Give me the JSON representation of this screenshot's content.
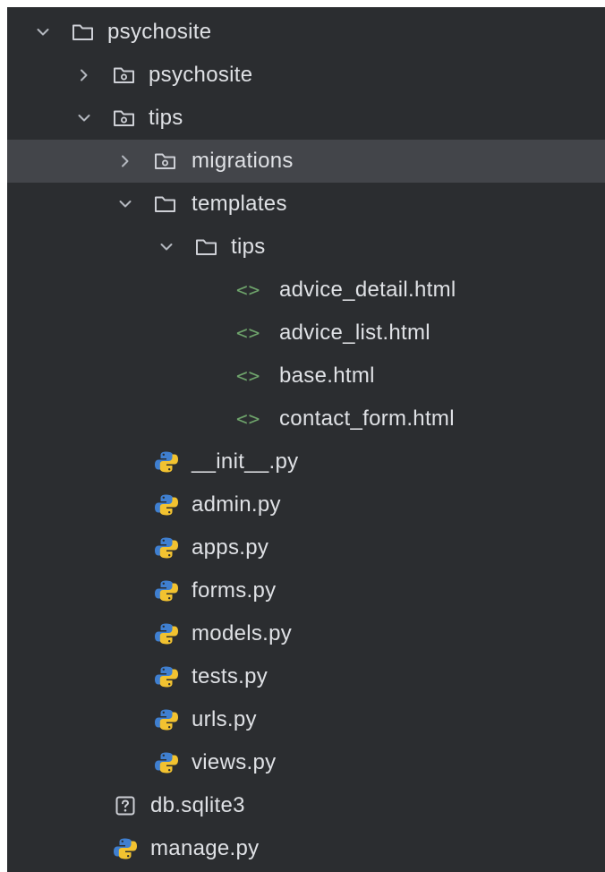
{
  "tree": {
    "items": [
      {
        "label": "psychosite",
        "icon": "folder-icon",
        "expanded": true
      },
      {
        "label": "psychosite",
        "icon": "package-folder-icon",
        "expanded": false
      },
      {
        "label": "tips",
        "icon": "package-folder-icon",
        "expanded": true
      },
      {
        "label": "migrations",
        "icon": "package-folder-icon",
        "expanded": false,
        "selected": true
      },
      {
        "label": "templates",
        "icon": "folder-icon",
        "expanded": true
      },
      {
        "label": "tips",
        "icon": "folder-icon",
        "expanded": true
      },
      {
        "label": "advice_detail.html",
        "icon": "html-file-icon"
      },
      {
        "label": "advice_list.html",
        "icon": "html-file-icon"
      },
      {
        "label": "base.html",
        "icon": "html-file-icon"
      },
      {
        "label": "contact_form.html",
        "icon": "html-file-icon"
      },
      {
        "label": "__init__.py",
        "icon": "python-file-icon"
      },
      {
        "label": "admin.py",
        "icon": "python-file-icon"
      },
      {
        "label": "apps.py",
        "icon": "python-file-icon"
      },
      {
        "label": "forms.py",
        "icon": "python-file-icon"
      },
      {
        "label": "models.py",
        "icon": "python-file-icon"
      },
      {
        "label": "tests.py",
        "icon": "python-file-icon"
      },
      {
        "label": "urls.py",
        "icon": "python-file-icon"
      },
      {
        "label": "views.py",
        "icon": "python-file-icon"
      },
      {
        "label": "db.sqlite3",
        "icon": "unknown-file-icon"
      },
      {
        "label": "manage.py",
        "icon": "python-file-icon"
      }
    ]
  },
  "colors": {
    "panel_background": "#2b2d30",
    "selected_row": "#43454a",
    "text": "#dfe1e5",
    "html_icon": "#6ea36b",
    "python_blue": "#3f7fd0",
    "python_yellow": "#f2c230"
  }
}
